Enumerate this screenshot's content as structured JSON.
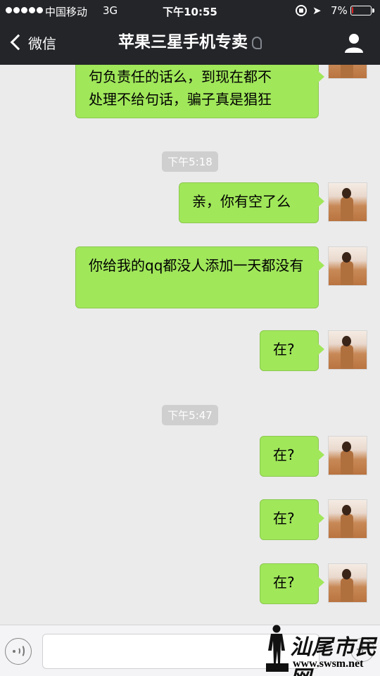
{
  "status_bar": {
    "carrier": "中国移动",
    "network": "3G",
    "time": "下午10:55",
    "battery_percent": "7%",
    "battery_level": 0.07
  },
  "nav": {
    "back_label": "微信",
    "title": "苹果三星手机专卖"
  },
  "messages": [
    {
      "kind": "partial",
      "lines": [
        "句负责任的话么，到现在都不",
        "处理不给句话，骗子真是猖狂"
      ]
    },
    {
      "kind": "time",
      "text": "下午5:18"
    },
    {
      "kind": "sent",
      "text": "亲，你有空了么"
    },
    {
      "kind": "sent",
      "text": "你给我的qq都没人添加一天都没有"
    },
    {
      "kind": "sent",
      "text": "在?"
    },
    {
      "kind": "time",
      "text": "下午5:47"
    },
    {
      "kind": "sent",
      "text": "在?"
    },
    {
      "kind": "sent",
      "text": "在?"
    },
    {
      "kind": "sent",
      "text": "在?"
    }
  ],
  "watermark": {
    "name": "汕尾市民网",
    "url": "www.swsm.net"
  }
}
